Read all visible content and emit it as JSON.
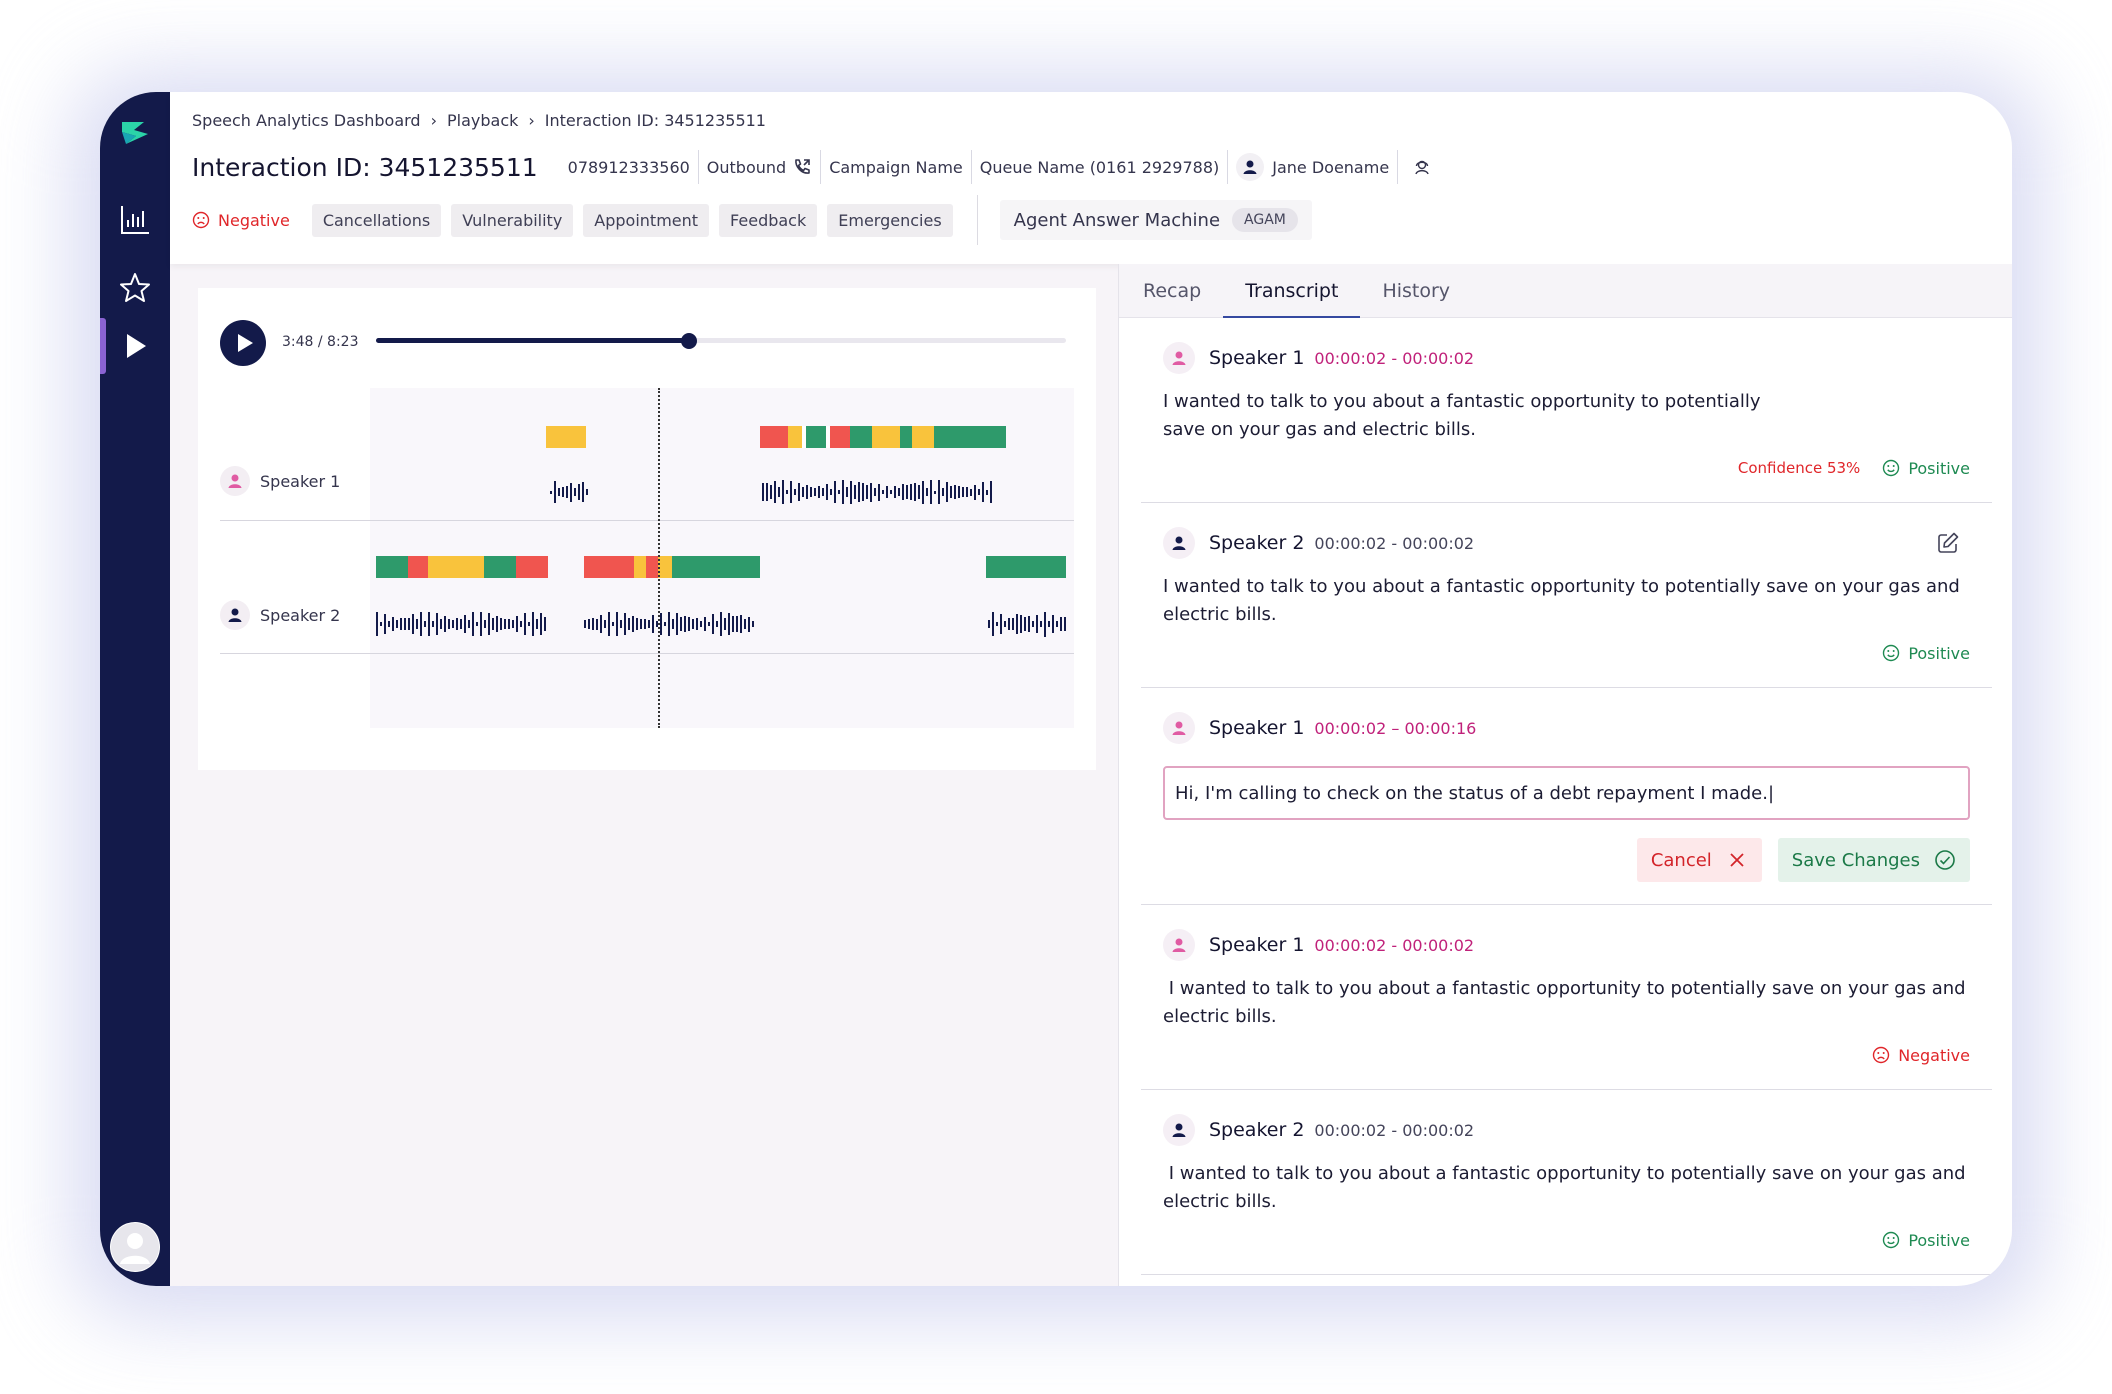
{
  "breadcrumb": [
    "Speech Analytics Dashboard",
    "Playback",
    "Interaction ID: 3451235511"
  ],
  "header": {
    "title": "Interaction ID: 3451235511",
    "phone": "078912333560",
    "direction": "Outbound",
    "campaign": "Campaign Name",
    "queue": "Queue Name (0161 2929788)",
    "agent": "Jane Doename"
  },
  "tags": {
    "sentiment": "Negative",
    "items": [
      "Cancellations",
      "Vulnerability",
      "Appointment",
      "Feedback",
      "Emergencies"
    ],
    "outcome_label": "Agent Answer Machine",
    "outcome_code": "AGAM"
  },
  "player": {
    "time": "3:48 / 8:23",
    "progress": 0.4533,
    "speakers": [
      "Speaker 1",
      "Speaker 2"
    ]
  },
  "tabs": [
    "Recap",
    "Transcript",
    "History"
  ],
  "transcript": [
    {
      "speaker": "Speaker 1",
      "time": "00:00:02 - 00:00:02",
      "text": "I wanted to talk to you about a fantastic opportunity to potentially save on your gas and electric bills.",
      "confidence": "Confidence 53%",
      "sentiment": "Positive"
    },
    {
      "speaker": "Speaker 2",
      "time": "00:00:02 - 00:00:02",
      "text": "I wanted to talk to you about a fantastic opportunity to potentially save on your gas and electric bills.",
      "sentiment": "Positive"
    },
    {
      "speaker": "Speaker 1",
      "time": "00:00:02 – 00:00:16",
      "input_value": "Hi, I'm calling to check on the status of a debt repayment I made.|",
      "cancel_label": "Cancel",
      "save_label": "Save Changes"
    },
    {
      "speaker": "Speaker 1",
      "time": "00:00:02 - 00:00:02",
      "text": " I wanted to talk to you about a fantastic opportunity to potentially save on your gas and electric bills.",
      "sentiment": "Negative"
    },
    {
      "speaker": "Speaker 2",
      "time": "00:00:02 - 00:00:02",
      "text": " I wanted to talk to you about a fantastic opportunity to potentially save on your gas and electric bills.",
      "sentiment": "Positive"
    }
  ],
  "colors": {
    "sidebar": "#131a4a",
    "accent": "#8a63d2",
    "negative": "#e0262a",
    "positive": "#1e8a52",
    "pink": "#c0217a",
    "seg_green": "#2e9a6b",
    "seg_red": "#f0554f",
    "seg_yellow": "#f9c33c"
  },
  "icons": [
    "logo-icon",
    "chart-icon",
    "star-icon",
    "play-icon",
    "avatar-icon",
    "phone-icon",
    "agent-icon",
    "headset-icon",
    "sad-face-icon",
    "smile-icon",
    "edit-icon",
    "close-icon",
    "check-circle-icon",
    "chevron-right-icon"
  ]
}
